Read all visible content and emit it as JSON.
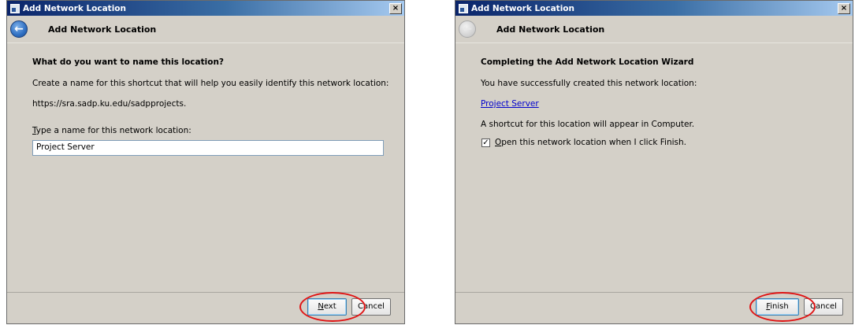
{
  "accent_color": "#e01515",
  "left": {
    "title": "Add Network Location",
    "header_title": "Add Network Location",
    "question": "What do you want to name this location?",
    "instructions": "Create a name for this shortcut that will help you easily identify this network location:",
    "address": "https://sra.sadp.ku.edu/sadpprojects.",
    "field_label_first": "T",
    "field_label_rest": "ype a name for this network location:",
    "name_value": "Project Server",
    "next_label_first": "N",
    "next_label_rest": "ext",
    "cancel_label": "Cancel",
    "close_glyph": "×",
    "back_icon_glyph": "←"
  },
  "right": {
    "title": "Add Network Location",
    "header_title": "Add Network Location",
    "heading": "Completing the Add Network Location Wizard",
    "success_text": "You have successfully created this network location:",
    "location_link": "Project Server",
    "shortcut_text": "A shortcut for this location will appear in Computer.",
    "checkbox_checked_glyph": "✓",
    "checkbox_label_first": "O",
    "checkbox_label_rest": "pen this network location when I click Finish.",
    "finish_label_first": "F",
    "finish_label_rest": "inish",
    "cancel_label": "Cancel",
    "close_glyph": "×",
    "back_icon_glyph": "←"
  }
}
